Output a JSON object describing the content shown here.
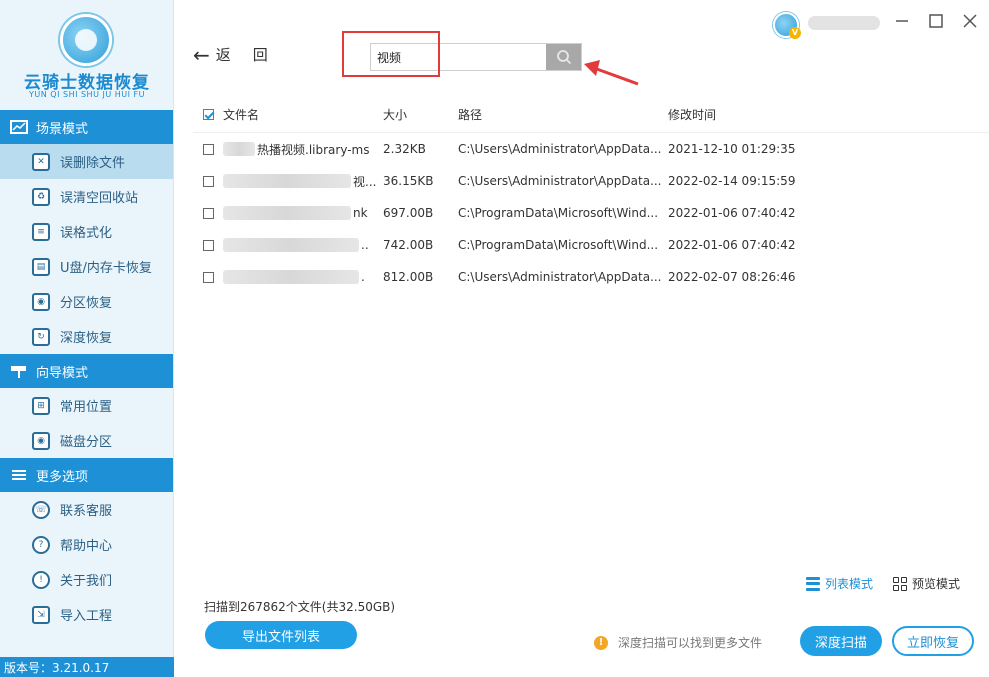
{
  "app": {
    "logo_title": "云骑士数据恢复",
    "logo_subtitle": "YUN QI SHI SHU JU HUI FU",
    "version": "版本号：3.21.0.17"
  },
  "sidebar": {
    "sections": [
      {
        "title": "场景模式",
        "items": [
          "误删除文件",
          "误清空回收站",
          "误格式化",
          "U盘/内存卡恢复",
          "分区恢复",
          "深度恢复"
        ]
      },
      {
        "title": "向导模式",
        "items": [
          "常用位置",
          "磁盘分区"
        ]
      },
      {
        "title": "更多选项",
        "items": [
          "联系客服",
          "帮助中心",
          "关于我们",
          "导入工程"
        ]
      }
    ]
  },
  "toolbar": {
    "back_label": "返回",
    "search_value": "视频"
  },
  "table": {
    "headers": {
      "name": "文件名",
      "size": "大小",
      "path": "路径",
      "time": "修改时间"
    },
    "rows": [
      {
        "name": "热播视频.library-ms",
        "size": "2.32KB",
        "path": "C:\\Users\\Administrator\\AppData...",
        "time": "2021-12-10 01:29:35"
      },
      {
        "name": "视...",
        "size": "36.15KB",
        "path": "C:\\Users\\Administrator\\AppData...",
        "time": "2022-02-14 09:15:59"
      },
      {
        "name": "nk",
        "size": "697.00B",
        "path": "C:\\ProgramData\\Microsoft\\Wind...",
        "time": "2022-01-06 07:40:42"
      },
      {
        "name": "..",
        "size": "742.00B",
        "path": "C:\\ProgramData\\Microsoft\\Wind...",
        "time": "2022-01-06 07:40:42"
      },
      {
        "name": ".",
        "size": "812.00B",
        "path": "C:\\Users\\Administrator\\AppData...",
        "time": "2022-02-07 08:26:46"
      }
    ]
  },
  "bottom": {
    "list_mode": "列表模式",
    "preview_mode": "预览模式",
    "scan_info": "扫描到267862个文件(共32.50GB)",
    "export_label": "导出文件列表",
    "deep_tip": "深度扫描可以找到更多文件",
    "deep_scan_label": "深度扫描",
    "recover_label": "立即恢复"
  },
  "colors": {
    "accent": "#1e90d6",
    "highlight": "#e23b3b"
  }
}
